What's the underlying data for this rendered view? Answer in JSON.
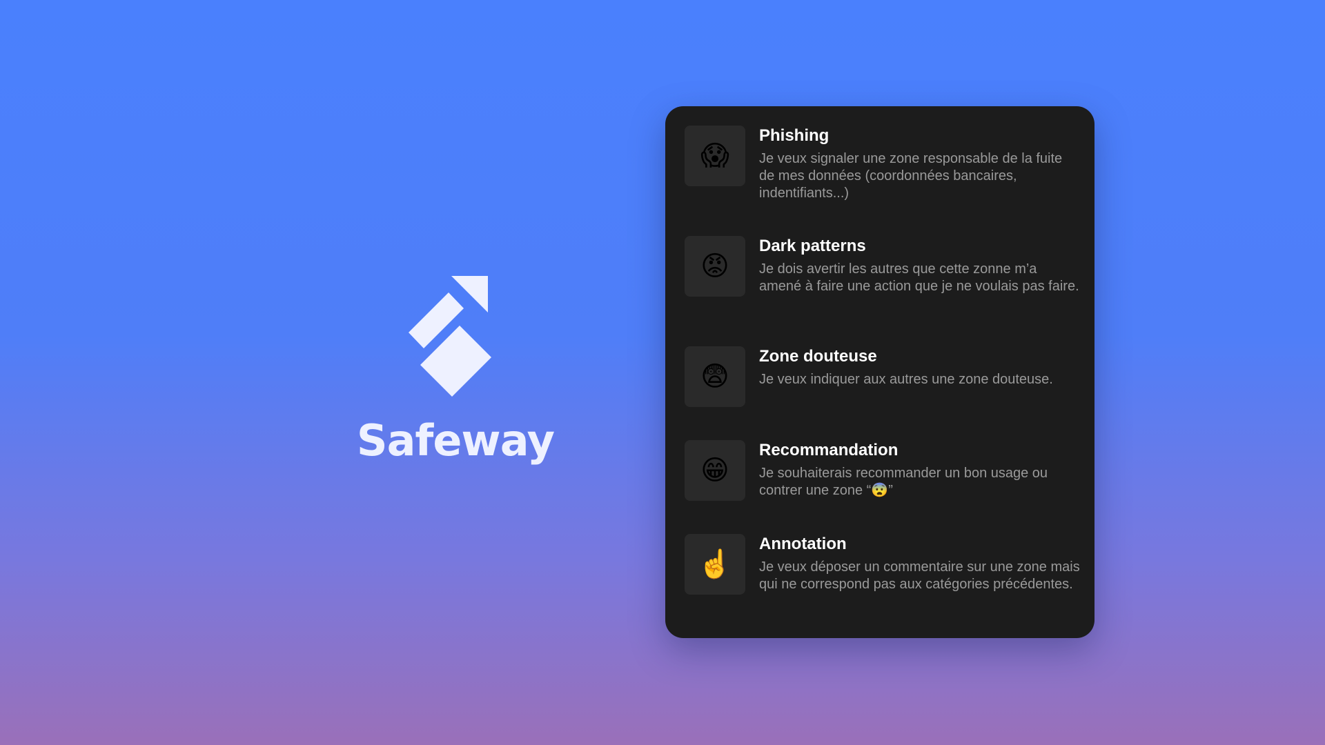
{
  "brand": {
    "name": "Safeway",
    "logo_icon": "safeway-arrow-logo",
    "logo_color": "#eef1ff"
  },
  "background": {
    "top_color": "#4a80fd",
    "bottom_color": "#9a70b9"
  },
  "panel": {
    "background_color": "#1c1c1c",
    "options": [
      {
        "icon": "face-screaming-in-fear-icon",
        "emoji": "😱",
        "title": "Phishing",
        "description": "Je veux signaler une zone responsable de la fuite de mes données (coordonnées bancaires, indentifiants...)"
      },
      {
        "icon": "angry-face-icon",
        "emoji": "😡",
        "title": "Dark patterns",
        "description": "Je dois avertir les autres que cette zonne m’a amené à faire une action que je ne voulais pas faire."
      },
      {
        "icon": "anxious-face-icon",
        "emoji": "😨",
        "title": "Zone douteuse",
        "description": "Je veux indiquer aux autres une zone douteuse."
      },
      {
        "icon": "grinning-face-icon",
        "emoji": "😁",
        "title": "Recommandation",
        "description": "Je souhaiterais recommander un bon usage ou contrer une zone “😨”"
      },
      {
        "icon": "index-pointing-up-icon",
        "emoji": "☝️",
        "title": "Annotation",
        "description": "Je veux déposer un commentaire sur une zone mais qui ne correspond pas aux catégories précédentes."
      }
    ]
  }
}
